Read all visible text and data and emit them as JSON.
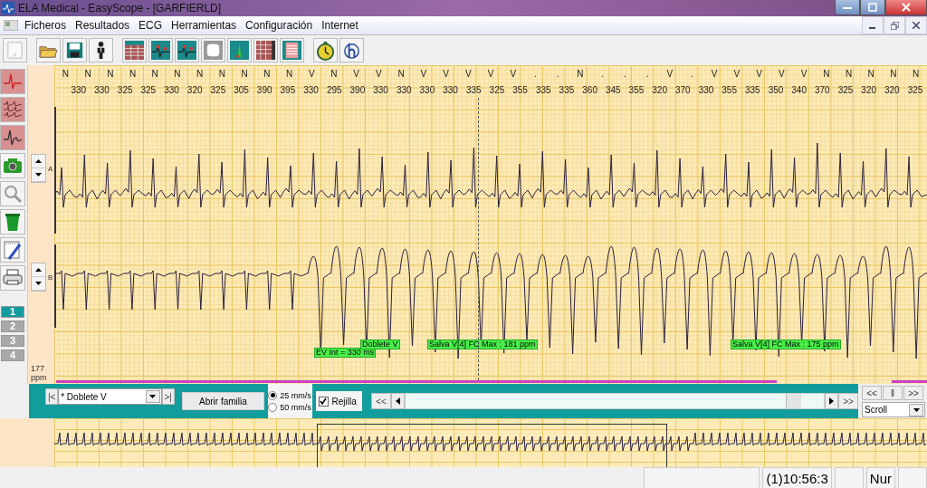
{
  "window": {
    "title": "ELA Medical - EasyScope - [GARFIERLD]"
  },
  "menu": [
    "Ficheros",
    "Resultados",
    "ECG",
    "Herramientas",
    "Configuración",
    "Internet"
  ],
  "channels": [
    {
      "label": "1",
      "selected": true
    },
    {
      "label": "2",
      "selected": false
    },
    {
      "label": "3",
      "selected": false
    },
    {
      "label": "4",
      "selected": false
    }
  ],
  "leads": [
    "A",
    "B"
  ],
  "heart_rate": {
    "value": "177",
    "unit": "ppm"
  },
  "beat_labels": [
    "N",
    "N",
    "N",
    "N",
    "N",
    "N",
    "N",
    "N",
    "N",
    "N",
    "N",
    "V",
    "N",
    "V",
    "V",
    "N",
    "V",
    "V",
    "V",
    "V",
    "V",
    ".",
    ".",
    "N",
    ".",
    ".",
    ".",
    "V",
    ".",
    "V",
    "V",
    "V",
    "V",
    "V",
    "N",
    "N",
    "N",
    "N",
    "N"
  ],
  "intervals": [
    "330",
    "330",
    "325",
    "325",
    "330",
    "320",
    "325",
    "305",
    "390",
    "395",
    "330",
    "295",
    "390",
    "330",
    "330",
    "330",
    "330",
    "335",
    "325",
    "355",
    "335",
    "335",
    "360",
    "345",
    "355",
    "320",
    "370",
    "330",
    "355",
    "335",
    "350",
    "340",
    "370",
    "325",
    "320",
    "320",
    "325"
  ],
  "annotations": [
    "EV Int = 330 ms",
    "Doblete V",
    "Salva V[4] FC Max : 181 ppm",
    "Salva V[4] FC Max : 175 ppm"
  ],
  "controls": {
    "first": "|<",
    "event_select": "* Doblete V",
    "last": ">|",
    "open_family_button": "Abrir familia",
    "speeds": [
      {
        "label": "25 mm/s",
        "selected": true
      },
      {
        "label": "50 mm/s",
        "selected": false
      }
    ],
    "grid": {
      "label": "Rejilla",
      "checked": true
    },
    "scroll_back": "<<",
    "scroll_forward": ">>"
  },
  "playback": {
    "buttons": [
      "<<",
      "‖",
      ">>"
    ],
    "mode": "Scroll"
  },
  "status_bar": {
    "time": "(1)10:56:3",
    "indicator": "Nur"
  }
}
